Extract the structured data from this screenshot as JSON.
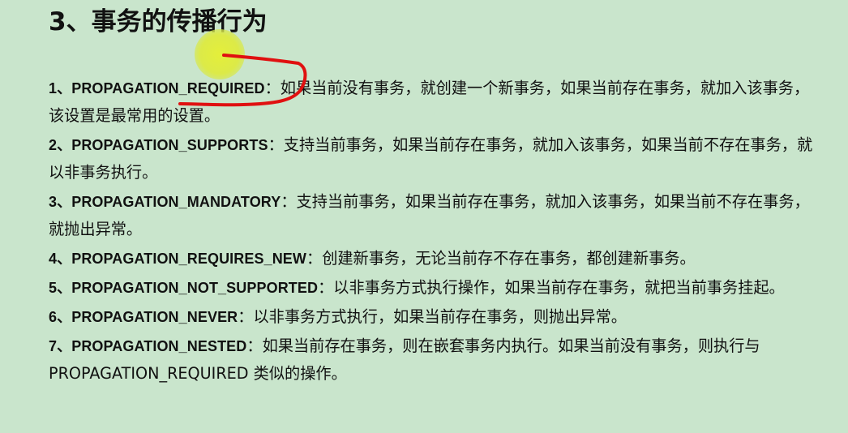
{
  "title": "3、事务的传播行为",
  "items": [
    {
      "num": "1、",
      "name": "PROPAGATION_REQUIRED",
      "sep": "：",
      "desc": "如果当前没有事务，就创建一个新事务，如果当前存在事务，就加入该事务，该设置是最常用的设置。"
    },
    {
      "num": "2、",
      "name": "PROPAGATION_SUPPORTS",
      "sep": "：",
      "desc": "支持当前事务，如果当前存在事务，就加入该事务，如果当前不存在事务，就以非事务执行。"
    },
    {
      "num": "3、",
      "name": "PROPAGATION_MANDATORY",
      "sep": "：",
      "desc": "支持当前事务，如果当前存在事务，就加入该事务，如果当前不存在事务，就抛出异常。"
    },
    {
      "num": "4、",
      "name": "PROPAGATION_REQUIRES_NEW",
      "sep": "：",
      "desc": "创建新事务，无论当前存不存在事务，都创建新事务。"
    },
    {
      "num": "5、",
      "name": "PROPAGATION_NOT_SUPPORTED",
      "sep": "：",
      "desc": "以非事务方式执行操作，如果当前存在事务，就把当前事务挂起。"
    },
    {
      "num": "6、",
      "name": "PROPAGATION_NEVER",
      "sep": "：",
      "desc": "以非事务方式执行，如果当前存在事务，则抛出异常。"
    },
    {
      "num": "7、",
      "name": "PROPAGATION_NESTED",
      "sep": "：",
      "desc": "如果当前存在事务，则在嵌套事务内执行。如果当前没有事务，则执行与 PROPAGATION_REQUIRED 类似的操作。"
    }
  ],
  "colors": {
    "background": "#c9e5cc",
    "text": "#111111",
    "annotation_pen": "#e01010",
    "cursor_highlight": "#dcea48"
  }
}
